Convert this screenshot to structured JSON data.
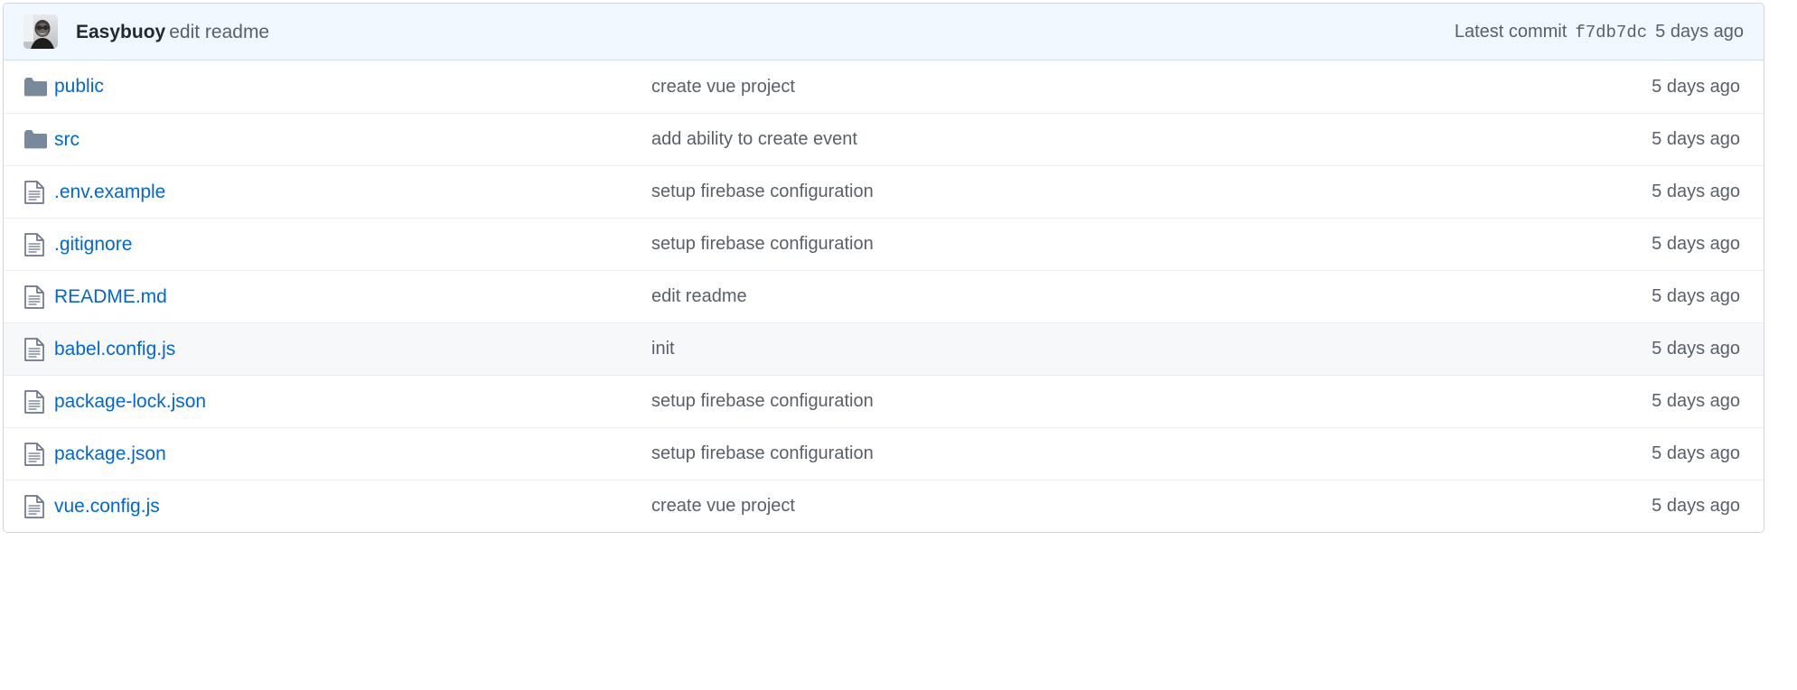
{
  "colors": {
    "link": "#0366d6",
    "muted_text": "#586069",
    "strong_text": "#24292e",
    "header_bg": "#f1f8ff",
    "header_border": "#c8e1ff",
    "row_border": "#eaecef",
    "table_border": "#d1d5da",
    "row_highlight_bg": "#f6f8fa",
    "folder_icon": "#79899c",
    "file_icon": "#6a768a"
  },
  "commit_header": {
    "avatar_name": "user-avatar",
    "author": "Easybuoy",
    "message": "edit readme",
    "latest_label": "Latest commit",
    "sha": "f7db7dc",
    "age": "5 days ago"
  },
  "files": [
    {
      "icon": "folder-icon",
      "type": "folder",
      "name": "public",
      "message": "create vue project",
      "age": "5 days ago",
      "highlight": false
    },
    {
      "icon": "folder-icon",
      "type": "folder",
      "name": "src",
      "message": "add ability to create event",
      "age": "5 days ago",
      "highlight": false
    },
    {
      "icon": "file-icon",
      "type": "file",
      "name": ".env.example",
      "message": "setup firebase configuration",
      "age": "5 days ago",
      "highlight": false
    },
    {
      "icon": "file-icon",
      "type": "file",
      "name": ".gitignore",
      "message": "setup firebase configuration",
      "age": "5 days ago",
      "highlight": false
    },
    {
      "icon": "file-icon",
      "type": "file",
      "name": "README.md",
      "message": "edit readme",
      "age": "5 days ago",
      "highlight": false
    },
    {
      "icon": "file-icon",
      "type": "file",
      "name": "babel.config.js",
      "message": "init",
      "age": "5 days ago",
      "highlight": true
    },
    {
      "icon": "file-icon",
      "type": "file",
      "name": "package-lock.json",
      "message": "setup firebase configuration",
      "age": "5 days ago",
      "highlight": false
    },
    {
      "icon": "file-icon",
      "type": "file",
      "name": "package.json",
      "message": "setup firebase configuration",
      "age": "5 days ago",
      "highlight": false
    },
    {
      "icon": "file-icon",
      "type": "file",
      "name": "vue.config.js",
      "message": "create vue project",
      "age": "5 days ago",
      "highlight": false
    }
  ]
}
